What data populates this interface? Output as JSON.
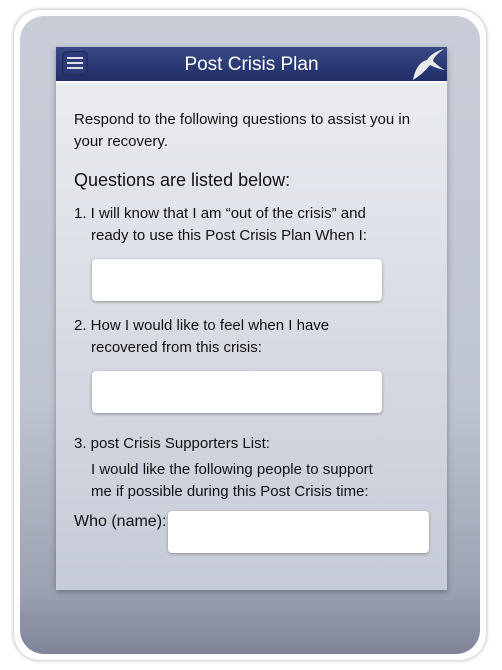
{
  "header": {
    "title": "Post Crisis Plan",
    "menu_icon": "hamburger-icon",
    "logo_icon": "swallow-bird-icon"
  },
  "intro": "Respond to the following questions to assist you in your recovery.",
  "questions_heading": "Questions are listed below:",
  "questions": [
    {
      "label_line1": "1. I will know that I am “out of the crisis” and",
      "label_line2": "ready to use this Post Crisis Plan When I:",
      "value": ""
    },
    {
      "label_line1": "2. How I would like to feel when I have",
      "label_line2": "recovered from this crisis:",
      "value": ""
    },
    {
      "label_line1": "3. post Crisis Supporters List:",
      "label_line2": "I would like the following people to support",
      "label_line3": "me if possible during this Post Crisis time:"
    }
  ],
  "who_label": "Who (name):",
  "who_value": ""
}
